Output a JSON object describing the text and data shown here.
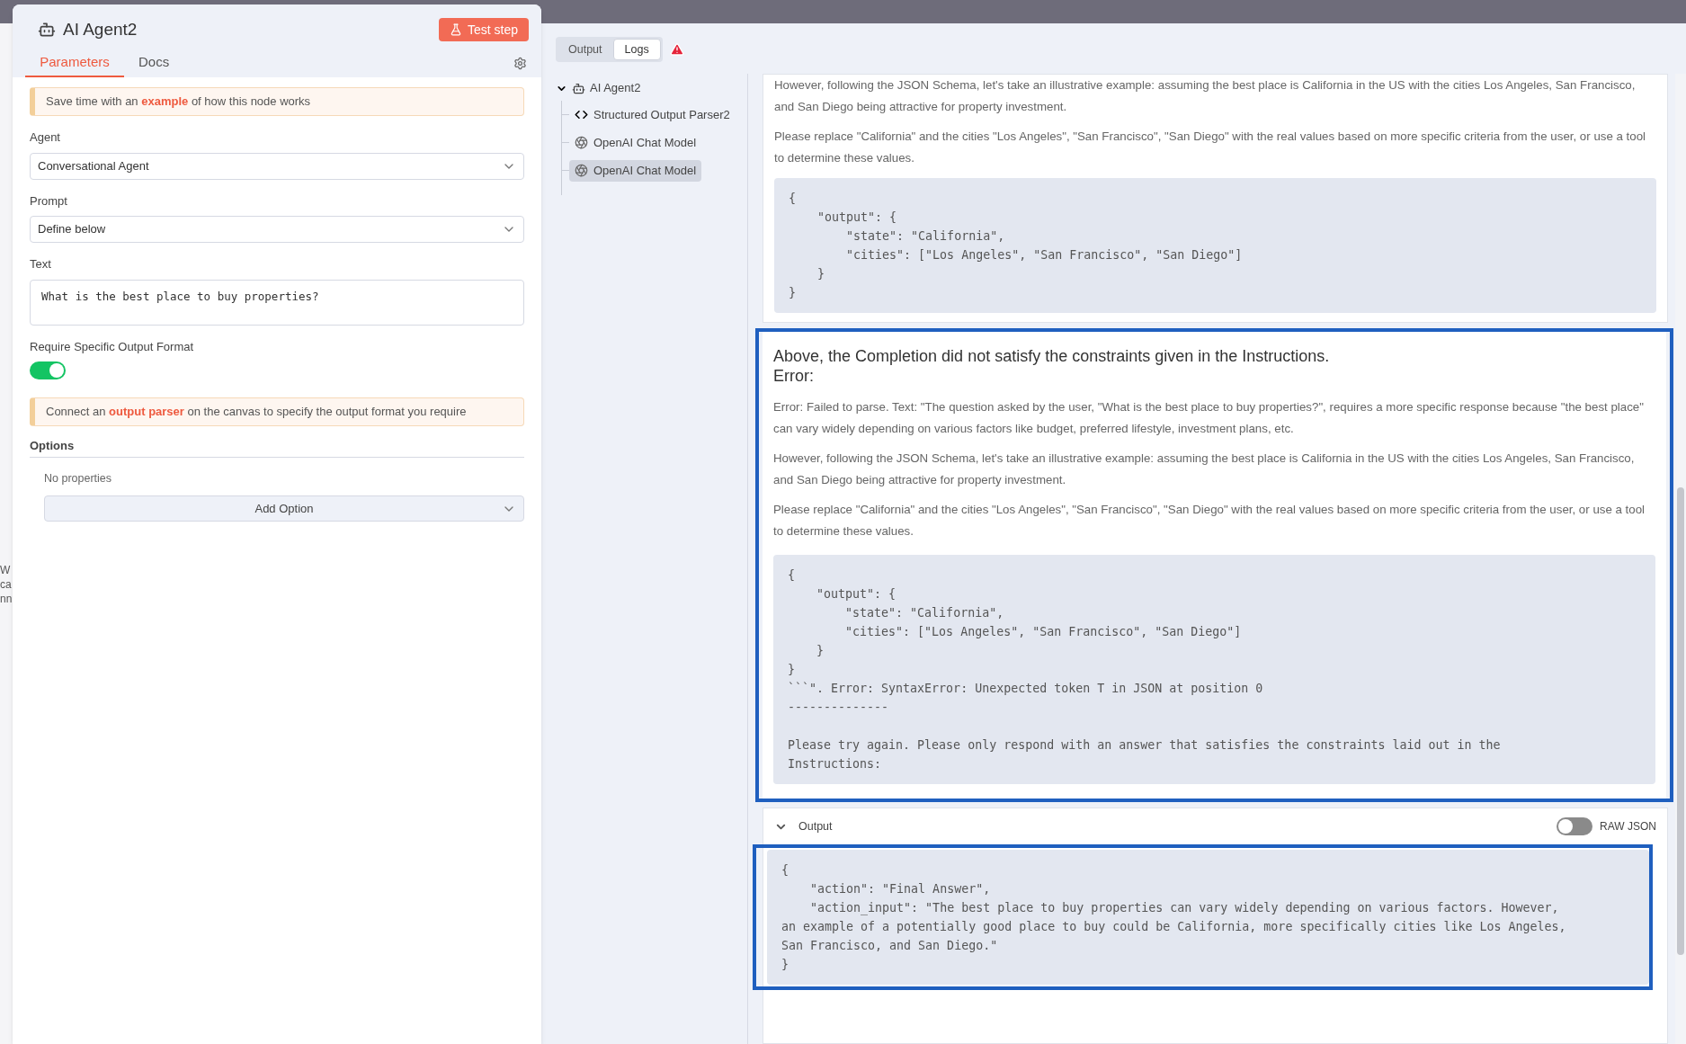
{
  "panel": {
    "title": "AI Agent2",
    "test_button": "Test step",
    "tabs": [
      {
        "label": "Parameters",
        "selected": true
      },
      {
        "label": "Docs",
        "selected": false
      }
    ],
    "example_notice": {
      "before": "Save time with an ",
      "link": "example",
      "after": " of how this node works"
    },
    "fields": [
      {
        "kind": "select",
        "label": "Agent",
        "value": "Conversational Agent"
      },
      {
        "kind": "select",
        "label": "Prompt",
        "value": "Define below"
      },
      {
        "kind": "textarea",
        "label": "Text",
        "value": "What is the best place to buy properties?"
      },
      {
        "kind": "toggle",
        "label": "Require Specific Output Format",
        "on": true
      }
    ],
    "parser_notice": {
      "before": "Connect an ",
      "link": "output parser",
      "after": " on the canvas to specify the output format you require"
    },
    "options": {
      "title": "Options",
      "empty": "No properties",
      "button": "Add Option"
    }
  },
  "canvas_fragments": [
    "W",
    "ca",
    "nn"
  ],
  "view_tabs": [
    {
      "label": "Output",
      "selected": false
    },
    {
      "label": "Logs",
      "selected": true
    }
  ],
  "tree": {
    "label": "AI Agent2",
    "expanded": true,
    "children": [
      {
        "label": "Structured Output Parser2",
        "kind": "parser",
        "selected": false
      },
      {
        "label": "OpenAI Chat Model",
        "kind": "model",
        "selected": false
      },
      {
        "label": "OpenAI Chat Model",
        "kind": "model",
        "selected": true
      }
    ]
  },
  "log": {
    "top_paragraphs": [
      "However, following the JSON Schema, let's take an illustrative example: assuming the best place is California in the US with the cities Los Angeles, San Francisco, and San Diego being attractive for property investment.",
      "Please replace \"California\" and the cities \"Los Angeles\", \"San Francisco\", \"San Diego\" with the real values based on more specific criteria from the user, or use a tool to determine these values."
    ],
    "top_code": "{\n    \"output\": {\n        \"state\": \"California\",\n        \"cities\": [\"Los Angeles\", \"San Francisco\", \"San Diego\"]\n    }\n}",
    "message": {
      "heading": "Above, the Completion did not satisfy the constraints given in the Instructions.\nError:",
      "paragraphs": [
        "Error: Failed to parse. Text: \"The question asked by the user, \"What is the best place to buy properties?\", requires a more specific response because \"the best place\" can vary widely depending on various factors like budget, preferred lifestyle, investment plans, etc.",
        "However, following the JSON Schema, let's take an illustrative example: assuming the best place is California in the US with the cities Los Angeles, San Francisco, and San Diego being attractive for property investment.",
        "Please replace \"California\" and the cities \"Los Angeles\", \"San Francisco\", \"San Diego\" with the real values based on more specific criteria from the user, or use a tool to determine these values."
      ],
      "code": "{\n    \"output\": {\n        \"state\": \"California\",\n        \"cities\": [\"Los Angeles\", \"San Francisco\", \"San Diego\"]\n    }\n}\n```\". Error: SyntaxError: Unexpected token T in JSON at position 0\n--------------\n\nPlease try again. Please only respond with an answer that satisfies the constraints laid out in the\nInstructions:"
    },
    "output": {
      "title": "Output",
      "expanded": true,
      "raw_json": {
        "label": "RAW JSON",
        "on": false
      },
      "code": "{\n    \"action\": \"Final Answer\",\n    \"action_input\": \"The best place to buy properties can vary widely depending on various factors. However,\nan example of a potentially good place to buy could be California, more specifically cities like Los Angeles,\nSan Francisco, and San Diego.\"\n}"
    }
  }
}
